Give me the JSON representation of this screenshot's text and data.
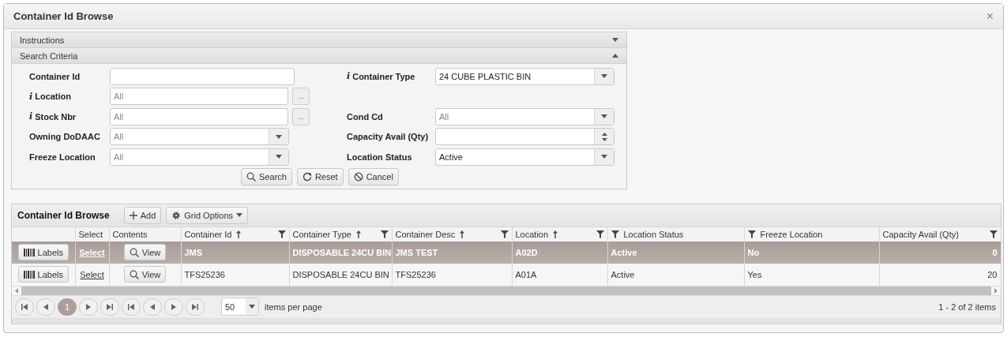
{
  "window": {
    "title": "Container Id Browse",
    "close": "×"
  },
  "sections": [
    {
      "label": "Instructions",
      "expanded": false
    },
    {
      "label": "Search Criteria",
      "expanded": true
    }
  ],
  "form": {
    "rows": [
      {
        "left": {
          "label": "Container Id",
          "kind": "text"
        },
        "right": {
          "label": "Container Type",
          "info": "i",
          "kind": "select",
          "value": "24 CUBE PLASTIC BIN"
        }
      },
      {
        "left": {
          "label": "Location",
          "info": "i",
          "kind": "lookup",
          "placeholder": "All",
          "lookup": "..."
        }
      },
      {
        "left": {
          "label": "Stock Nbr",
          "info": "i",
          "kind": "lookup",
          "placeholder": "All",
          "lookup": "..."
        },
        "right": {
          "label": "Cond Cd",
          "kind": "select",
          "placeholder": "All"
        }
      },
      {
        "left": {
          "label": "Owning DoDAAC",
          "kind": "select",
          "placeholder": "All"
        },
        "right": {
          "label": "Capacity Avail (Qty)",
          "kind": "spinner"
        }
      },
      {
        "left": {
          "label": "Freeze Location",
          "kind": "select",
          "placeholder": "All"
        },
        "right": {
          "label": "Location Status",
          "kind": "select",
          "value": "Active"
        }
      }
    ],
    "buttons": [
      {
        "label": "Search",
        "kind": "search"
      },
      {
        "label": "Reset",
        "kind": "reset"
      },
      {
        "label": "Cancel",
        "kind": "cancel"
      }
    ]
  },
  "grid": {
    "title": "Container Id Browse",
    "toolbar": [
      {
        "label": "Add",
        "kind": "add"
      },
      {
        "label": "Grid Options",
        "kind": "menu"
      }
    ],
    "columns": [
      {
        "kind": "plain"
      },
      {
        "label": "Select",
        "kind": "plain"
      },
      {
        "label": "Contents",
        "kind": "plain"
      },
      {
        "label": "Container Id",
        "kind": "sort-filter"
      },
      {
        "label": "Container Type",
        "kind": "sort-filter"
      },
      {
        "label": "Container Desc",
        "kind": "sort-filter"
      },
      {
        "label": "Location",
        "kind": "sort-filter"
      },
      {
        "label": "Location Status",
        "kind": "filter-left"
      },
      {
        "label": "Freeze Location",
        "kind": "filter-left"
      },
      {
        "label": "Capacity Avail (Qty)",
        "kind": "filter-right"
      }
    ],
    "rows": [
      {
        "selected": true,
        "cells": [
          {
            "kind": "labels",
            "text": "Labels"
          },
          {
            "kind": "link",
            "text": "Select"
          },
          {
            "kind": "view",
            "text": "View"
          },
          {
            "kind": "text",
            "text": "JMS"
          },
          {
            "kind": "text",
            "text": "DISPOSABLE 24CU BIN"
          },
          {
            "kind": "text",
            "text": "JMS TEST"
          },
          {
            "kind": "text",
            "text": "A02D"
          },
          {
            "kind": "text",
            "text": "Active"
          },
          {
            "kind": "text",
            "text": "No"
          },
          {
            "kind": "number",
            "text": "0"
          }
        ]
      },
      {
        "selected": false,
        "cells": [
          {
            "kind": "labels",
            "text": "Labels"
          },
          {
            "kind": "link",
            "text": "Select"
          },
          {
            "kind": "view",
            "text": "View"
          },
          {
            "kind": "text",
            "text": "TFS25236"
          },
          {
            "kind": "text",
            "text": "DISPOSABLE 24CU BIN"
          },
          {
            "kind": "text",
            "text": "TFS25236"
          },
          {
            "kind": "text",
            "text": "A01A"
          },
          {
            "kind": "text",
            "text": "Active"
          },
          {
            "kind": "text",
            "text": "Yes"
          },
          {
            "kind": "number",
            "text": "20"
          }
        ]
      }
    ],
    "pager": {
      "pages": [
        {
          "label": "1",
          "selected": true
        }
      ],
      "page_size": "50",
      "page_size_label": "items per page",
      "summary": "1 - 2 of 2 items"
    }
  }
}
